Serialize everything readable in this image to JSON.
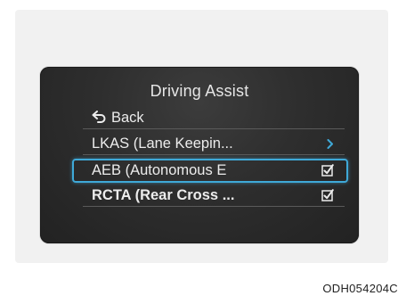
{
  "screen": {
    "title": "Driving Assist",
    "back_label": "Back",
    "items": [
      {
        "label": "LKAS (Lane Keepin...",
        "control": "chevron"
      },
      {
        "label": "AEB (Autonomous E",
        "control": "checkbox",
        "checked": true,
        "focused": true
      },
      {
        "label": "RCTA (Rear Cross ...",
        "control": "checkbox",
        "checked": true
      }
    ]
  },
  "image_code": "ODH054204C",
  "colors": {
    "focus_accent": "#3fa9d8",
    "chevron": "#3fa9d8",
    "text": "#ececec"
  }
}
